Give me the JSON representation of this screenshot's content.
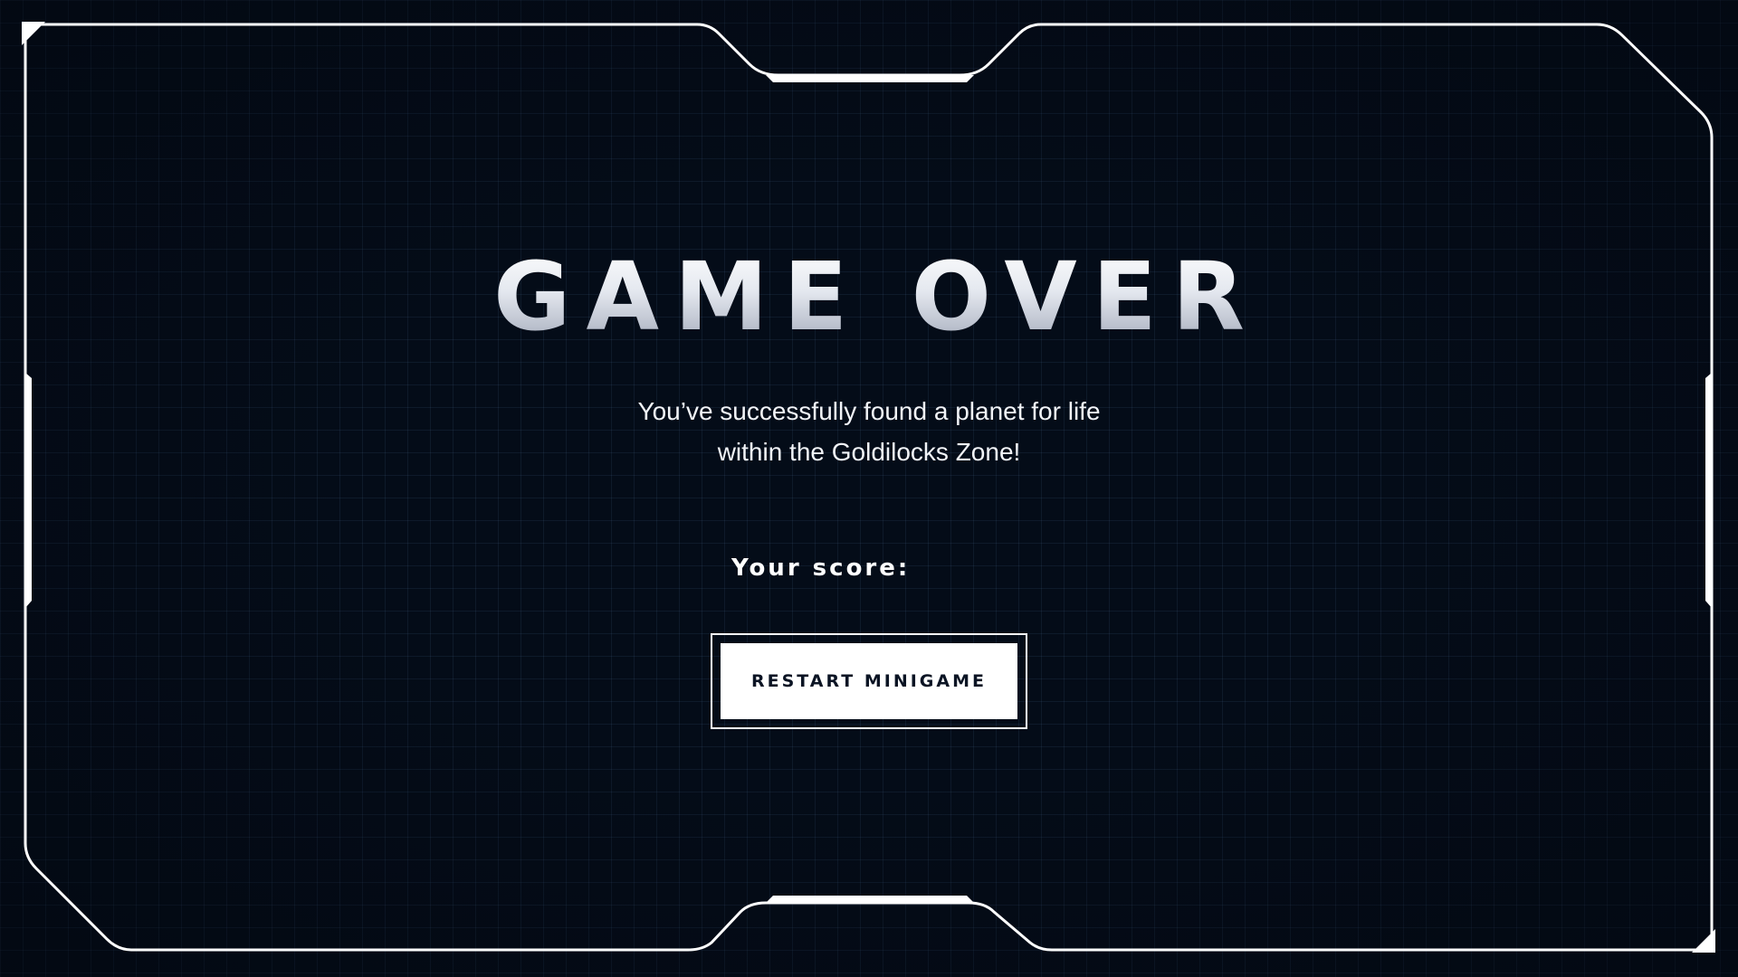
{
  "screen": {
    "title": "GAME OVER",
    "message_line1": "You’ve successfully found a planet for life",
    "message_line2": "within the Goldilocks Zone!",
    "score_label": "Your score:",
    "score_value": "",
    "restart_label": "RESTART MINIGAME"
  },
  "theme": {
    "background": "#040c18",
    "grid_color": "#46648c",
    "frame_color": "#ffffff",
    "text_color": "#ffffff",
    "button_text_color": "#0b1424"
  }
}
